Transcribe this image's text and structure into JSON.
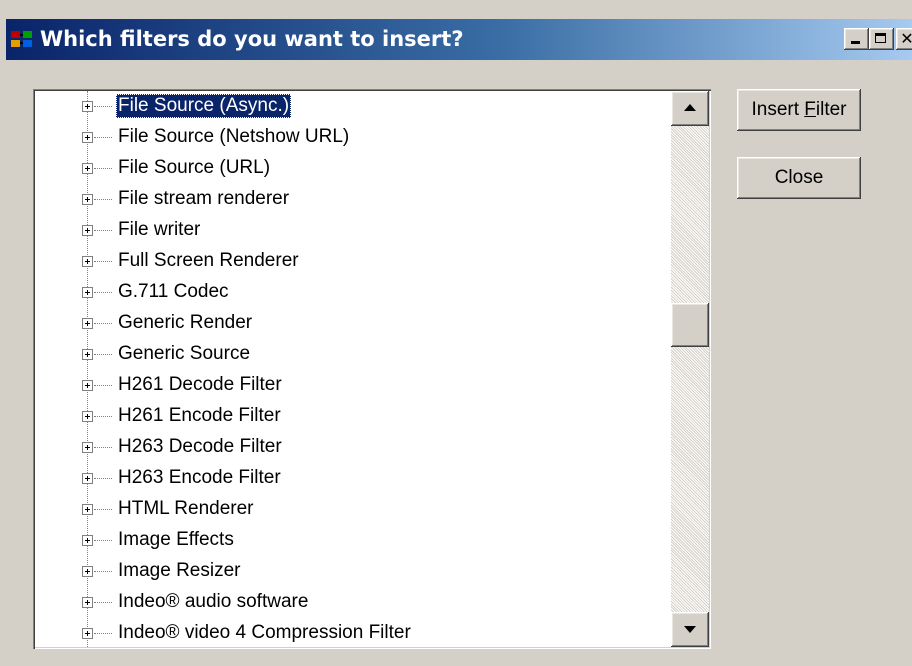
{
  "window": {
    "title": "Which filters do you want to insert?",
    "caption_buttons": {
      "minimize": "",
      "maximize": "",
      "close": "✕"
    }
  },
  "filter_list": {
    "selected_index": 0,
    "scroll_position_percent": 40,
    "items": [
      "File Source (Async.)",
      "File Source (Netshow URL)",
      "File Source (URL)",
      "File stream renderer",
      "File writer",
      "Full Screen Renderer",
      "G.711 Codec",
      "Generic Render",
      "Generic Source",
      "H261 Decode Filter",
      "H261 Encode Filter",
      "H263 Decode Filter",
      "H263 Encode Filter",
      "HTML Renderer",
      "Image Effects",
      "Image Resizer",
      "Indeo® audio software",
      "Indeo® video 4 Compression Filter"
    ]
  },
  "buttons": {
    "insert_filter": {
      "pre": "Insert ",
      "accel": "F",
      "post": "ilter"
    },
    "close": "Close"
  },
  "icons": {
    "app": "filter-graph-icon",
    "expander": "plus-expander-icon"
  }
}
